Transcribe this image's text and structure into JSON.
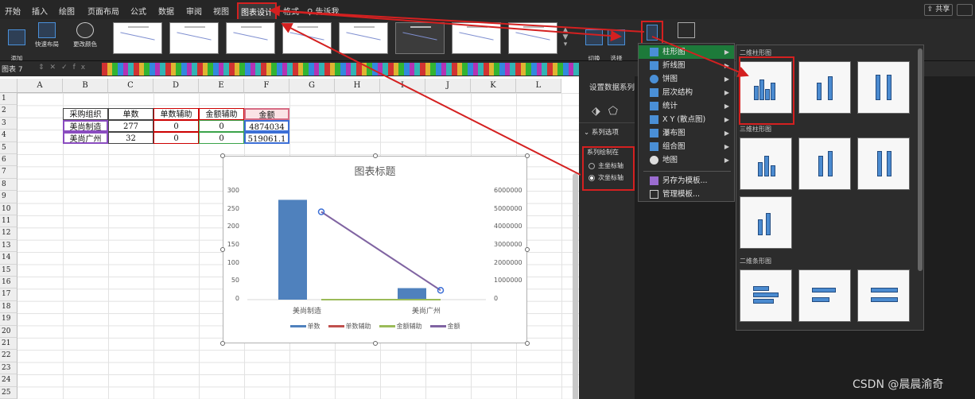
{
  "tabs": [
    "开始",
    "插入",
    "绘图",
    "页面布局",
    "公式",
    "数据",
    "审阅",
    "视图",
    "图表设计",
    "格式",
    "告诉我"
  ],
  "share_label": "共享",
  "ribbon": {
    "add_element": "添加\n图表元素",
    "quick_layout": "快速布局",
    "change_color": "更改颜色",
    "switch_rowcol": "切换\n行/列",
    "select_data": "选择\n数据"
  },
  "formula_bar": {
    "namebox": "图表 7",
    "fx": "fx"
  },
  "columns": [
    "A",
    "B",
    "C",
    "D",
    "E",
    "F",
    "G",
    "H",
    "I",
    "J",
    "K",
    "L"
  ],
  "rows": [
    "1",
    "2",
    "3",
    "4",
    "5",
    "6",
    "7",
    "8",
    "9",
    "10",
    "11",
    "12",
    "13",
    "14",
    "15",
    "16",
    "17",
    "18",
    "19",
    "20",
    "21",
    "22",
    "23",
    "24",
    "25"
  ],
  "table": {
    "headers": [
      "采购组织",
      "单数",
      "单数辅助",
      "金额辅助",
      "金额"
    ],
    "rows": [
      [
        "美尚制造",
        "277",
        "0",
        "0",
        "4874034"
      ],
      [
        "美尚广州",
        "32",
        "0",
        "0",
        "519061.1"
      ]
    ]
  },
  "chart_data": {
    "type": "bar",
    "title": "图表标题",
    "categories": [
      "美尚制造",
      "美尚广州"
    ],
    "series": [
      {
        "name": "单数",
        "type": "bar",
        "axis": "primary",
        "values": [
          277,
          32
        ],
        "color": "#4f81bd"
      },
      {
        "name": "单数辅助",
        "type": "bar",
        "axis": "primary",
        "values": [
          0,
          0
        ],
        "color": "#c0504d"
      },
      {
        "name": "金额辅助",
        "type": "line",
        "axis": "primary",
        "values": [
          0,
          0
        ],
        "color": "#9bbb59"
      },
      {
        "name": "金额",
        "type": "line",
        "axis": "secondary",
        "values": [
          4874034,
          519061.1
        ],
        "color": "#8064a2"
      }
    ],
    "ylim": [
      0,
      300
    ],
    "yticks": [
      "300",
      "250",
      "200",
      "150",
      "100",
      "50",
      "0"
    ],
    "y2lim": [
      0,
      6000000
    ],
    "y2ticks": [
      "6000000",
      "5000000",
      "4000000",
      "3000000",
      "2000000",
      "1000000",
      "0"
    ],
    "legend": "bottom"
  },
  "panel": {
    "title": "设置数据系列",
    "series_options": "系列选项",
    "plot_on": "系列绘制在",
    "primary_axis": "主坐标轴",
    "secondary_axis": "次坐标轴"
  },
  "menu": [
    "柱形图",
    "折线图",
    "饼图",
    "层次结构",
    "统计",
    "X Y (散点图)",
    "瀑布图",
    "组合图",
    "地图",
    "另存为模板...",
    "管理模板..."
  ],
  "gallery": {
    "sec1": "二维柱形图",
    "sec2": "三维柱形图",
    "sec3": "二维条形图"
  },
  "watermark": "CSDN @晨晨渝奇",
  "colors": {
    "accent": "#d42020",
    "menu_selected": "#1d7a3a",
    "bar": "#4f81bd",
    "line": "#8064a2"
  }
}
